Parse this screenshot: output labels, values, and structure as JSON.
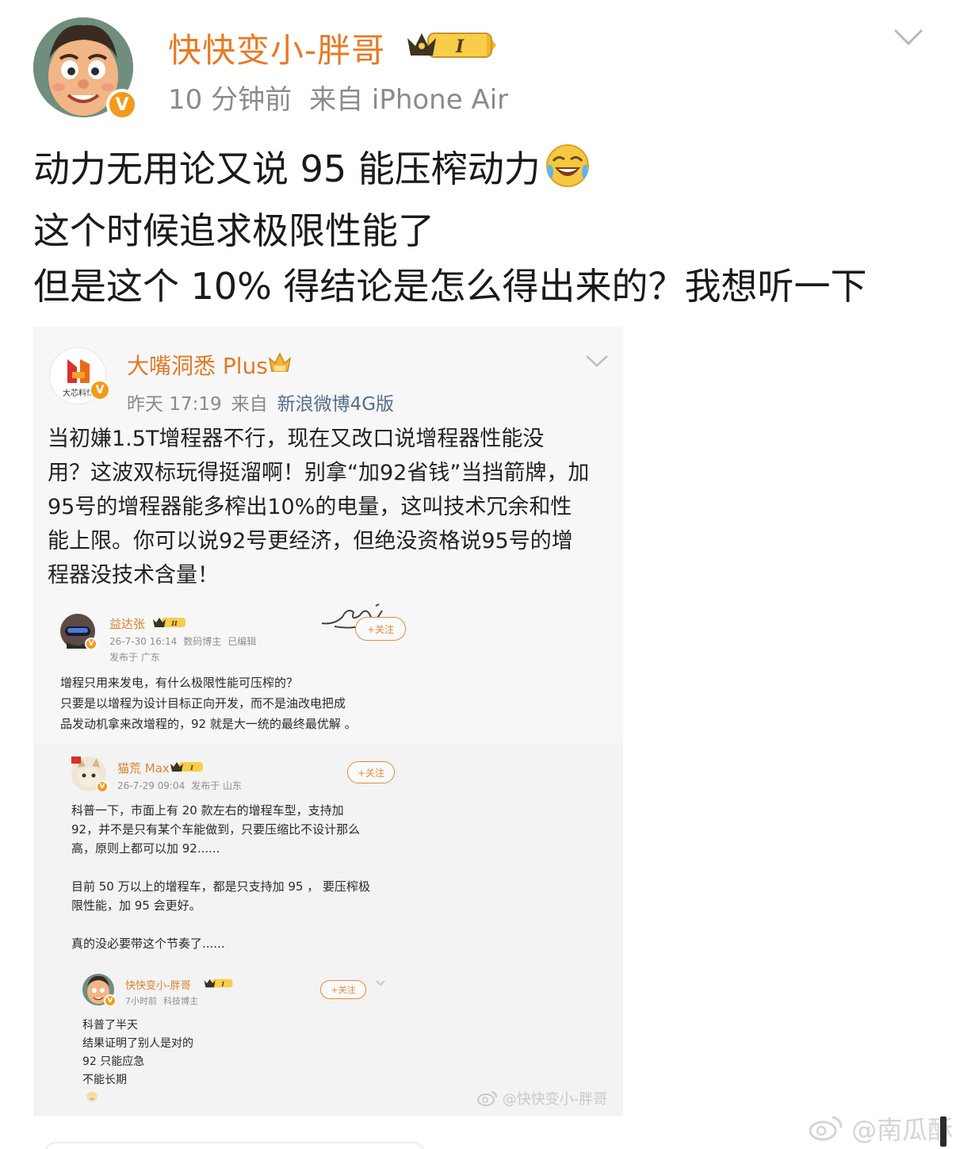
{
  "post": {
    "author": "快快变小-胖哥",
    "time": "10 分钟前",
    "source": "来自 iPhone Air",
    "level_badge": "I",
    "text_lines": [
      "动力无用论又说 95 能压榨动力",
      "这个时候追求极限性能了",
      "但是这个 10% 得结论是怎么得出来的？我想听一下"
    ],
    "emoji": "laughing-crying-emoji"
  },
  "quoted": {
    "author": "大嘴洞悉 Plus",
    "avatar_text": "大芯料忙",
    "time": "昨天 17:19",
    "source_prefix": "来自",
    "source": "新浪微博4G版",
    "text_lines": [
      "当初嫌1.5T增程器不行，现在又改口说增程器性能没",
      "用？这波双标玩得挺溜啊！别拿“加92省钱”当挡箭牌，加",
      "95号的增程器能多榨出10%的电量，这叫技术冗余和性",
      "能上限。你可以说92号更经济，但绝没资格说95号的增",
      "程器没技术含量！"
    ]
  },
  "comments": [
    {
      "name": "益达张",
      "level": "II",
      "time": "26-7-30 16:14",
      "role": "数码博主",
      "edited": "已编辑",
      "location": "发布于 广东",
      "follow": "+关注",
      "lines": [
        "增程只用来发电，有什么极限性能可压榨的？",
        "只要是以增程为设计目标正向开发，而不是油改电把成",
        "品发动机拿来改增程的，92 就是大一统的最终最优解 。"
      ]
    },
    {
      "name": "猫荒 Max",
      "level": "I",
      "time": "26-7-29 09:04",
      "location": "发布于 山东",
      "follow": "+关注",
      "lines": [
        "科普一下，市面上有 20 款左右的增程车型，支持加",
        "92，并不是只有某个车能做到，只要压缩比不设计那么",
        "高，原则上都可以加 92......",
        "",
        "目前 50 万以上的增程车，都是只支持加 95 ， 要压榨极",
        "限性能，加 95 会更好。",
        "",
        "真的没必要带这个节奏了......"
      ]
    },
    {
      "name": "快快变小-胖哥",
      "level": "I",
      "time": "7小时前",
      "role": "科技博主",
      "follow": "+关注",
      "lines": [
        "科普了半天",
        "结果证明了别人是对的",
        "92 只能应急",
        "不能长期"
      ]
    }
  ],
  "watermark_inner": "@快快变小-胖哥",
  "watermark_main": "@南瓜酥",
  "colors": {
    "author_orange": "#e87a24",
    "meta_gray": "#8b8b8b",
    "verified_badge": "#f29b1b",
    "source_blue": "#556c88"
  }
}
